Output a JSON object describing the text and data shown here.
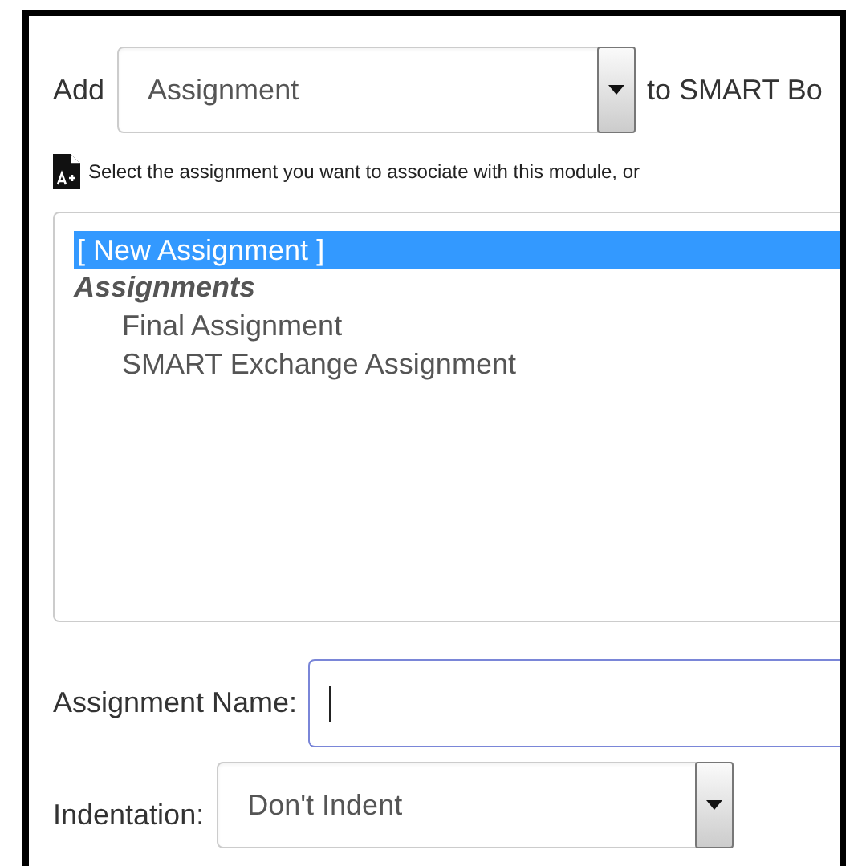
{
  "add_row": {
    "label": "Add",
    "select": {
      "value": "Assignment"
    },
    "suffix": "to SMART Bo"
  },
  "instruction": "Select the assignment you want to associate with this module, or",
  "listbox": {
    "items": [
      {
        "kind": "option",
        "label": "[ New Assignment ]",
        "selected": true
      },
      {
        "kind": "group",
        "label": "Assignments",
        "children": [
          {
            "kind": "option",
            "label": "Final Assignment",
            "selected": false
          },
          {
            "kind": "option",
            "label": "SMART Exchange Assignment",
            "selected": false
          }
        ]
      }
    ]
  },
  "name_field": {
    "label": "Assignment Name:",
    "focused": true
  },
  "indentation": {
    "label": "Indentation:",
    "select": {
      "value": "Don't Indent"
    }
  }
}
